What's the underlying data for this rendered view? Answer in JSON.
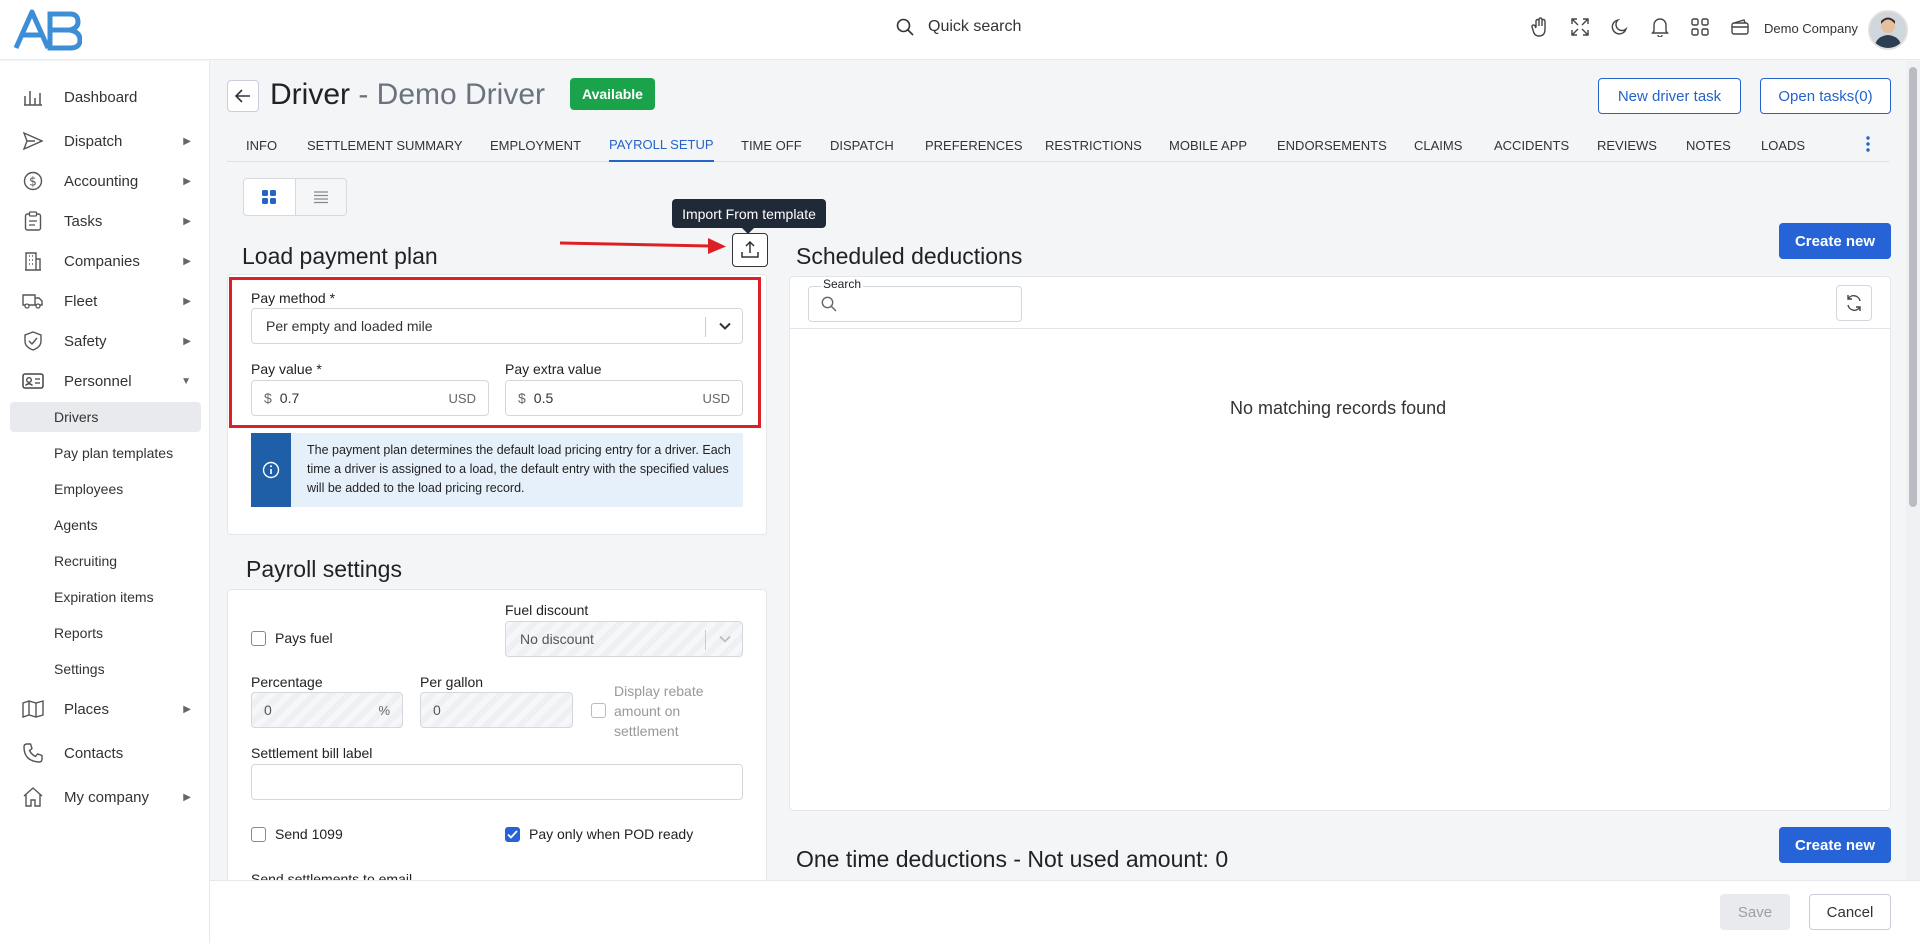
{
  "topbar": {
    "search_label": "Quick search",
    "company_name": "Demo Company",
    "icons": [
      "hand-icon",
      "fullscreen-icon",
      "moon-icon",
      "bell-icon",
      "apps-grid-icon",
      "wallet-icon"
    ]
  },
  "sidebar": {
    "items": [
      {
        "label": "Dashboard",
        "icon": "dashboard-icon",
        "has_arrow": false
      },
      {
        "label": "Dispatch",
        "icon": "send-icon",
        "has_arrow": true
      },
      {
        "label": "Accounting",
        "icon": "dollar-icon",
        "has_arrow": true
      },
      {
        "label": "Tasks",
        "icon": "clipboard-icon",
        "has_arrow": true
      },
      {
        "label": "Companies",
        "icon": "building-icon",
        "has_arrow": true
      },
      {
        "label": "Fleet",
        "icon": "truck-icon",
        "has_arrow": true
      },
      {
        "label": "Safety",
        "icon": "shield-icon",
        "has_arrow": true
      },
      {
        "label": "Personnel",
        "icon": "id-card-icon",
        "has_arrow": true,
        "expanded": true
      }
    ],
    "personnel_sub": [
      "Drivers",
      "Pay plan templates",
      "Employees",
      "Agents",
      "Recruiting",
      "Expiration items",
      "Reports",
      "Settings"
    ],
    "bottom_items": [
      {
        "label": "Places",
        "icon": "map-icon",
        "has_arrow": true
      },
      {
        "label": "Contacts",
        "icon": "phone-icon",
        "has_arrow": false
      },
      {
        "label": "My company",
        "icon": "home-icon",
        "has_arrow": true
      }
    ],
    "active_sub": "Drivers"
  },
  "header": {
    "title": "Driver",
    "subtitle": " - Demo Driver",
    "status": "Available",
    "new_task_btn": "New driver task",
    "open_tasks_btn": "Open tasks(0)"
  },
  "tabs": [
    "INFO",
    "SETTLEMENT SUMMARY",
    "EMPLOYMENT",
    "PAYROLL SETUP",
    "TIME OFF",
    "DISPATCH",
    "PREFERENCES",
    "RESTRICTIONS",
    "MOBILE APP",
    "ENDORSEMENTS",
    "CLAIMS",
    "ACCIDENTS",
    "REVIEWS",
    "NOTES",
    "LOADS"
  ],
  "active_tab": "PAYROLL SETUP",
  "load_payment_plan": {
    "title": "Load payment plan",
    "tooltip": "Import From template",
    "pay_method_label": "Pay method *",
    "pay_method_value": "Per empty and loaded mile",
    "pay_value_label": "Pay value *",
    "pay_value": "0.7",
    "pay_extra_label": "Pay extra value",
    "pay_extra_value": "0.5",
    "currency_symbol": "$",
    "currency": "USD",
    "info_text": "The payment plan determines the default load pricing entry for a driver. Each time a driver is assigned to a load, the default entry with the specified values will be added to the load pricing record."
  },
  "payroll_settings": {
    "title": "Payroll settings",
    "pays_fuel_label": "Pays fuel",
    "fuel_discount_label": "Fuel discount",
    "fuel_discount_value": "No discount",
    "percentage_label": "Percentage",
    "percentage_value": "0",
    "percentage_suffix": "%",
    "per_gallon_label": "Per gallon",
    "per_gallon_value": "0",
    "rebate_label": "Display rebate amount on settlement",
    "bill_label_label": "Settlement bill label",
    "bill_label_value": "",
    "send1099_label": "Send 1099",
    "pay_pod_label": "Pay only when POD ready",
    "send_email_label": "Send settlements to email"
  },
  "scheduled_deductions": {
    "title": "Scheduled deductions",
    "create_btn": "Create new",
    "search_label": "Search",
    "search_value": "",
    "empty_message": "No matching records found"
  },
  "one_time_deductions": {
    "title": "One time deductions - Not used amount: 0",
    "create_btn": "Create new"
  },
  "footer": {
    "save": "Save",
    "cancel": "Cancel"
  },
  "colors": {
    "primary": "#2563d6",
    "status_green": "#1aa34a",
    "highlight_red": "#dd1f26"
  }
}
